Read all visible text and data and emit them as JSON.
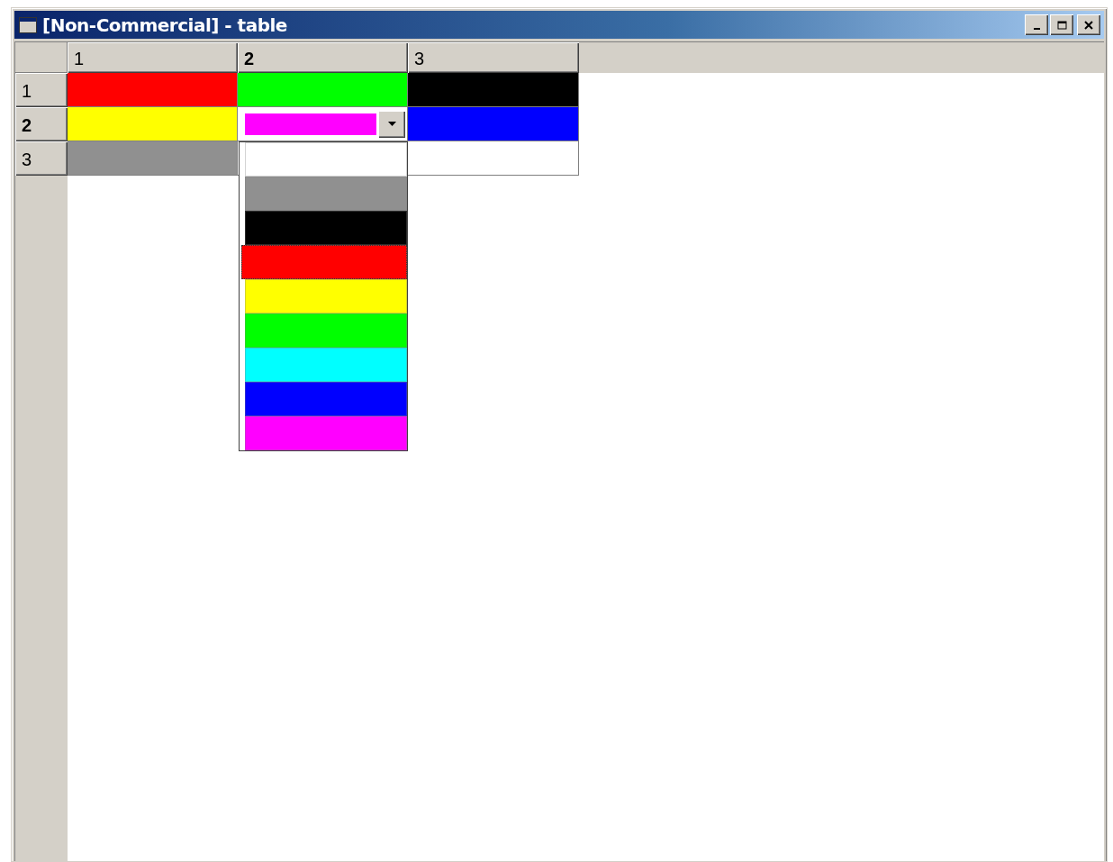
{
  "window": {
    "title": "[Non-Commercial] - table"
  },
  "table": {
    "columns": [
      {
        "label": "1",
        "selected": false
      },
      {
        "label": "2",
        "selected": true
      },
      {
        "label": "3",
        "selected": false
      }
    ],
    "rows": [
      {
        "label": "1",
        "selected": false,
        "cells": [
          {
            "kind": "swatch",
            "color": "#ff0000"
          },
          {
            "kind": "swatch",
            "color": "#00ff00"
          },
          {
            "kind": "swatch",
            "color": "#000000"
          }
        ]
      },
      {
        "label": "2",
        "selected": true,
        "cells": [
          {
            "kind": "swatch",
            "color": "#ffff00"
          },
          {
            "kind": "dropdown",
            "color": "#ff00ff"
          },
          {
            "kind": "swatch",
            "color": "#0000ff"
          }
        ]
      },
      {
        "label": "3",
        "selected": false,
        "cells": [
          {
            "kind": "swatch",
            "color": "#909090"
          },
          {
            "kind": "covered"
          },
          {
            "kind": "swatch",
            "color": "#ffffff"
          }
        ]
      }
    ]
  },
  "dropdown_list": {
    "options": [
      {
        "color": "#ffffff",
        "selected": false
      },
      {
        "color": "#909090",
        "selected": false
      },
      {
        "color": "#000000",
        "selected": false
      },
      {
        "color": "#ff0000",
        "selected": true
      },
      {
        "color": "#ffff00",
        "selected": false
      },
      {
        "color": "#00ff00",
        "selected": false
      },
      {
        "color": "#00ffff",
        "selected": false
      },
      {
        "color": "#0000ff",
        "selected": false
      },
      {
        "color": "#ff00ff",
        "selected": false
      }
    ]
  }
}
